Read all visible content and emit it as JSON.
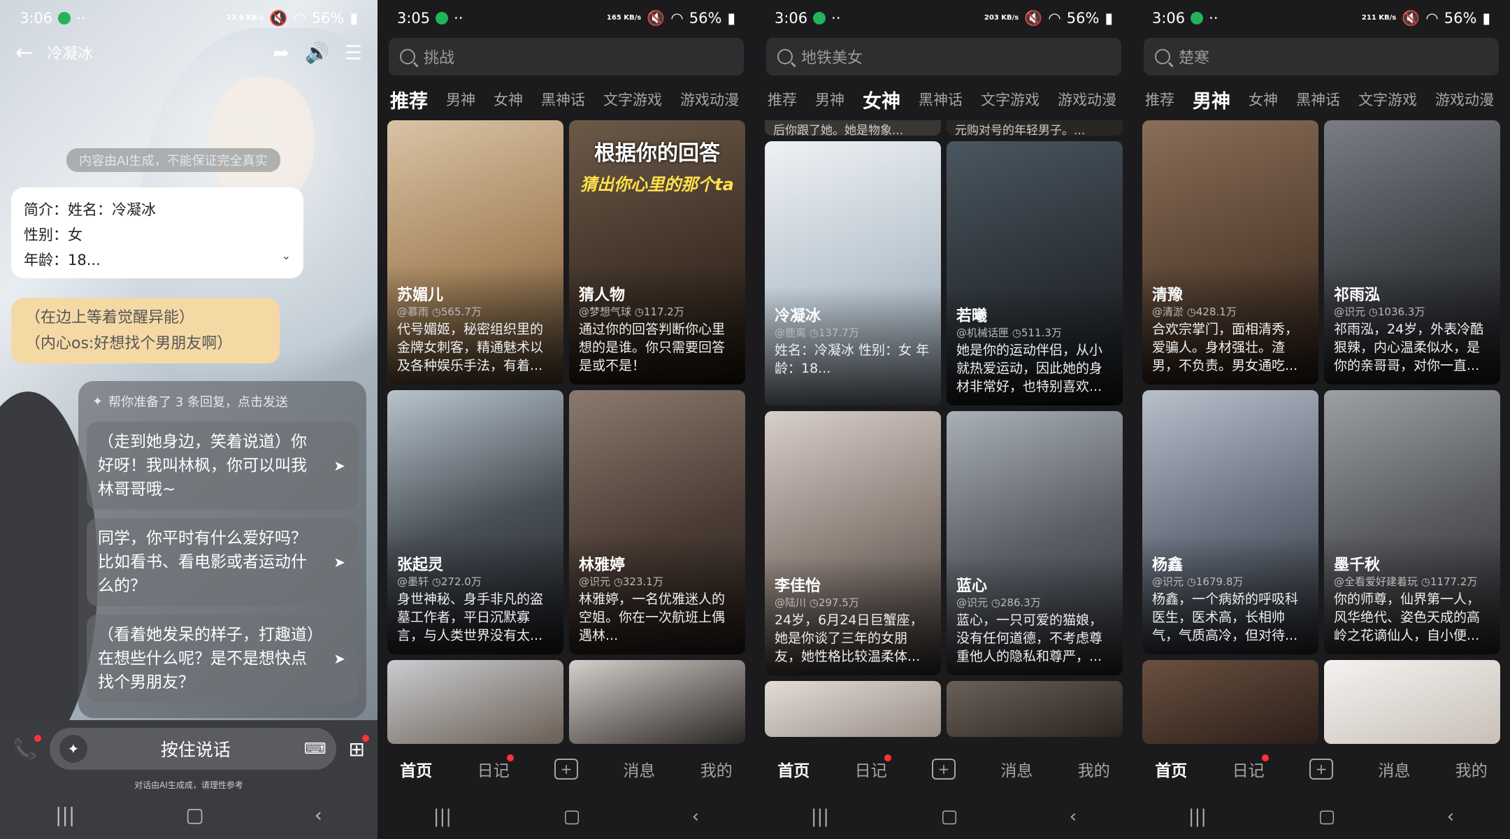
{
  "panels": {
    "chat": {
      "status": {
        "time": "3:06",
        "speed": "22.6 KB/s",
        "battery": "56%"
      },
      "title": "冷凝冰",
      "ai_note": "内容由AI生成，不能保证完全真实",
      "intro_line1": "简介：姓名：冷凝冰",
      "intro_line2": "性别：女",
      "intro_line3": "年龄：18...",
      "action_line1": "（在边上等着觉醒异能）",
      "action_line2": "（内心os:好想找个男朋友啊）",
      "replies_header": "帮你准备了 3 条回复，点击发送",
      "replies": [
        "（走到她身边，笑着说道）你好呀！我叫林枫，你可以叫我林哥哥哦~",
        "同学，你平时有什么爱好吗？比如看书、看电影或者运动什么的？",
        "（看着她发呆的样子，打趣道）在想些什么呢？是不是想快点找个男朋友？"
      ],
      "talk_button": "按住说话",
      "disclaimer": "对话由AI生成成，请理性参考"
    },
    "feed1": {
      "status": {
        "time": "3:05",
        "speed": "165 KB/s",
        "battery": "56%"
      },
      "search_placeholder": "挑战",
      "tabs": [
        "推荐",
        "男神",
        "女神",
        "黑神话",
        "文字游戏",
        "游戏动漫"
      ],
      "cards": [
        {
          "name": "苏媚儿",
          "author": "@慕雨",
          "plays": "565.7万",
          "desc": "代号媚姬，秘密组织里的金牌女刺客，精通魅术以及各种娱乐手法，有着..."
        },
        {
          "banner1": "根据你的回答",
          "banner2": "猜出你心里的那个ta",
          "name": "猜人物",
          "author": "@梦想气球",
          "plays": "117.2万",
          "desc": "通过你的回答判断你心里想的是谁。你只需要回答是或不是！"
        },
        {
          "name": "张起灵",
          "author": "@墨轩",
          "plays": "272.0万",
          "desc": "身世神秘、身手非凡的盗墓工作者，平日沉默寡言，与人类世界没有太..."
        },
        {
          "name": "林雅婷",
          "author": "@识元",
          "plays": "323.1万",
          "desc": "林雅婷，一名优雅迷人的空姐。你在一次航班上偶遇林..."
        }
      ]
    },
    "feed2": {
      "status": {
        "time": "3:06",
        "speed": "203 KB/s",
        "battery": "56%"
      },
      "search_placeholder": "地铁美女",
      "tabs": [
        "推荐",
        "男神",
        "女神",
        "黑神话",
        "文字游戏",
        "游戏动漫"
      ],
      "top_snippet_left": "后你跟了她。她是物象...",
      "top_snippet_right": "元购对号的年轻男子。...",
      "cards": [
        {
          "name": "冷凝冰",
          "author": "@鹿离",
          "plays": "137.7万",
          "desc": "姓名：冷凝冰 性别：女 年龄：18..."
        },
        {
          "name": "若曦",
          "author": "@机械话匣",
          "plays": "511.3万",
          "desc": "她是你的运动伴侣，从小就热爱运动，因此她的身材非常好，也特别喜欢..."
        },
        {
          "name": "李佳怡",
          "author": "@陆川",
          "plays": "297.5万",
          "desc": "24岁，6月24日巨蟹座，她是你谈了三年的女朋友，她性格比较温柔体..."
        },
        {
          "name": "蓝心",
          "author": "@识元",
          "plays": "286.3万",
          "desc": "蓝心，一只可爱的猫娘，没有任何道德，不考虑尊重他人的隐私和尊严，..."
        }
      ]
    },
    "feed3": {
      "status": {
        "time": "3:06",
        "speed": "211 KB/s",
        "battery": "56%"
      },
      "search_placeholder": "楚寒",
      "tabs": [
        "推荐",
        "男神",
        "女神",
        "黑神话",
        "文字游戏",
        "游戏动漫"
      ],
      "cards": [
        {
          "name": "清豫",
          "author": "@清淤",
          "plays": "428.1万",
          "desc": "合欢宗掌门，面相清秀，爱骗人。身材强壮。渣男，不负责。男女通吃..."
        },
        {
          "name": "祁雨泓",
          "author": "@识元",
          "plays": "1036.3万",
          "desc": "祁雨泓，24岁，外表冷酷狠辣，内心温柔似水，是你的亲哥哥，对你一直..."
        },
        {
          "name": "杨鑫",
          "author": "@识元",
          "plays": "1679.8万",
          "desc": "杨鑫，一个病娇的呼吸科医生，医术高，长相帅气，气质高冷，但对待..."
        },
        {
          "name": "墨千秋",
          "author": "@全看爱好建着玩",
          "plays": "1177.2万",
          "desc": "你的师尊，仙界第一人，风华绝代、姿色天成的高岭之花谪仙人，自小便..."
        }
      ]
    }
  },
  "bottom_tabs": [
    "首页",
    "日记",
    "创建",
    "消息",
    "我的"
  ],
  "colors": {
    "bg": "#1b1b1d",
    "search": "#2e2e31",
    "action_bubble": "#f5d9a5",
    "red_dot": "#ff3333"
  },
  "icons": [
    "back-arrow-icon",
    "share-icon",
    "speaker-icon",
    "menu-icon",
    "search-icon",
    "phone-icon",
    "sparkle-icon",
    "keyboard-icon",
    "add-icon"
  ]
}
